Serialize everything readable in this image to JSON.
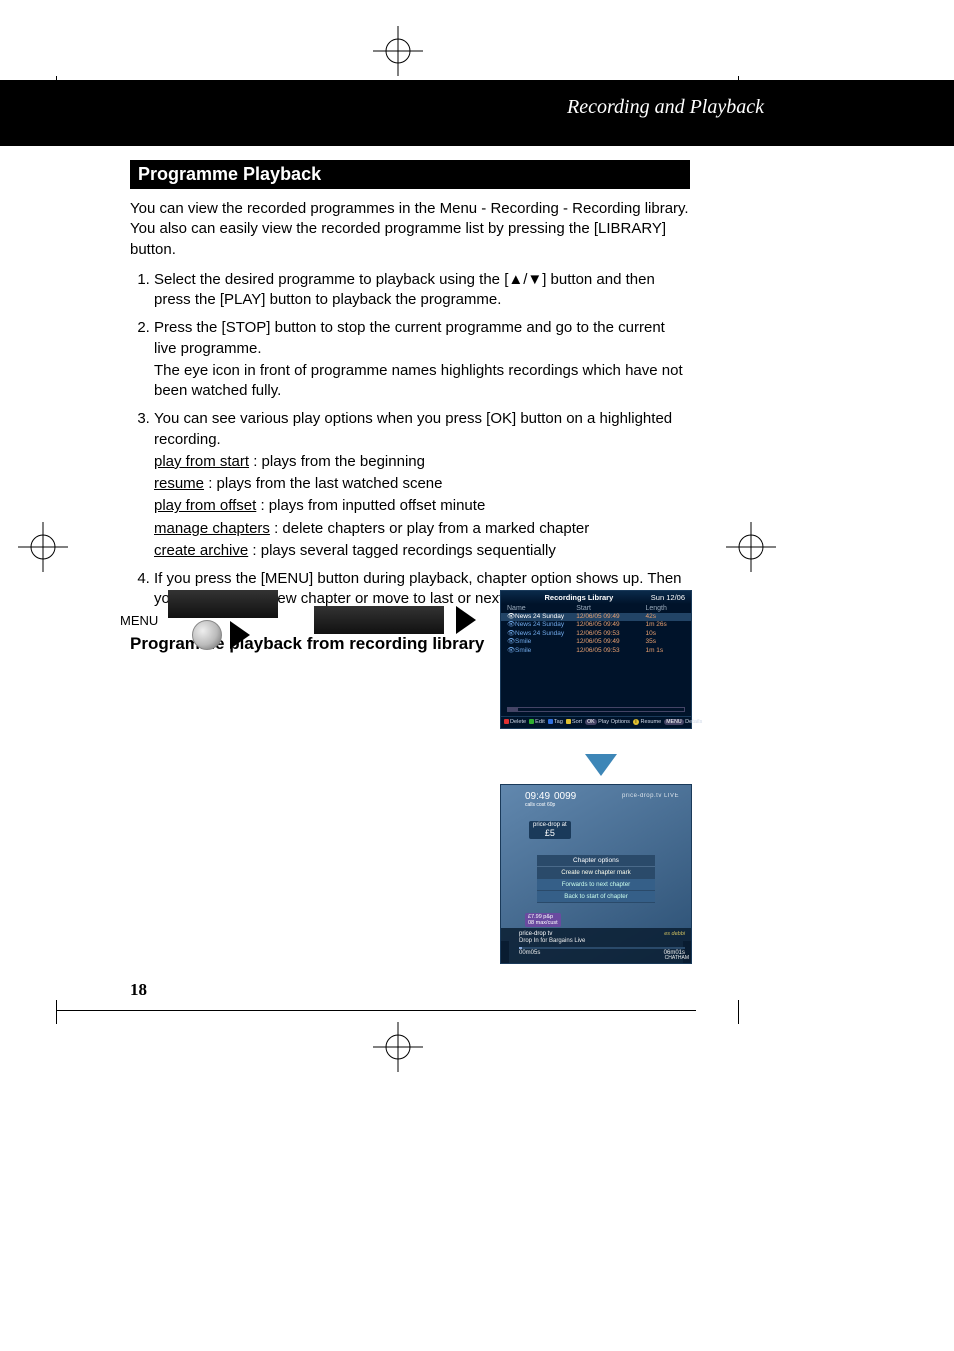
{
  "page_header": "Recording and Playback",
  "section_title": "Programme Playback",
  "intro": "You can view the recorded programmes in the Menu - Recording - Recording library. You also can easily view the recorded programme list by pressing the [LIBRARY] button.",
  "steps": [
    {
      "n": "1",
      "text": "Select the desired programme to playback using the [▲/▼] button and then press the [PLAY] button to playback the programme."
    },
    {
      "n": "2",
      "text": "Press the [STOP] button to stop the current programme and go to the current live programme.",
      "note": "The eye icon in front of programme names highlights recordings which have not been watched fully."
    },
    {
      "n": "3",
      "text": "You can see various play options when you press [OK] button on a highlighted recording.",
      "options": [
        {
          "k": "play from start",
          "v": " : plays from the beginning"
        },
        {
          "k": "resume",
          "v": " : plays from the last watched scene"
        },
        {
          "k": "play from offset",
          "v": " : plays from inputted offset minute"
        },
        {
          "k": "manage chapters",
          "v": " : delete chapters or play from a marked chapter"
        },
        {
          "k": "create archive",
          "v": " : plays several tagged recordings sequentially"
        }
      ]
    },
    {
      "n": "4",
      "text": "If you press the [MENU] button during playback, chapter option shows up. Then you can create a new chapter or move to last or next chapter."
    }
  ],
  "subsection": "Programme playback from recording library",
  "flow": {
    "menu_label": "MENU"
  },
  "recordings": {
    "title": "Recordings Library",
    "date": "Sun 12/06",
    "cols": {
      "name": "Name",
      "start": "Start",
      "length": "Length"
    },
    "rows": [
      {
        "name": "News 24 Sunday",
        "start": "12/06/05  09:49",
        "length": "42s",
        "sel": true
      },
      {
        "name": "News 24 Sunday",
        "start": "12/06/05  09:49",
        "length": "1m 26s",
        "sel": false
      },
      {
        "name": "News 24 Sunday",
        "start": "12/06/05  09:53",
        "length": "10s",
        "sel": false
      },
      {
        "name": "Smile",
        "start": "12/06/05  09:49",
        "length": "35s",
        "sel": false
      },
      {
        "name": "Smile",
        "start": "12/06/05  09:53",
        "length": "1m 1s",
        "sel": false
      }
    ],
    "footer": {
      "delete": "Delete",
      "edit": "Edit",
      "tag": "Tag",
      "sort": "Sort",
      "ok": "OK",
      "play": "Play Options",
      "ii": "i",
      "resume": "Resume",
      "menu": "MENU",
      "details": "Details"
    }
  },
  "chapter": {
    "time": "09:49",
    "num": "0099",
    "sub": "calls cost 60p",
    "brand": "price-drop.tv LIVE",
    "tag_top": "price-drop at",
    "tag_big": "£5",
    "menu_header": "Chapter options",
    "menu_items": [
      "Create new chapter mark",
      "Forwards to next chapter",
      "Back to start of chapter"
    ],
    "badge1": "£7.99 p&p",
    "badge2": "08 max/cust",
    "info_title": "price-drop tv",
    "info_line": "Drop In for Bargains Live",
    "pos": "00m05s",
    "dur": "06m01s",
    "side_right1": "es debbi",
    "side_right2": "CHATHAM"
  },
  "page_number": "18"
}
